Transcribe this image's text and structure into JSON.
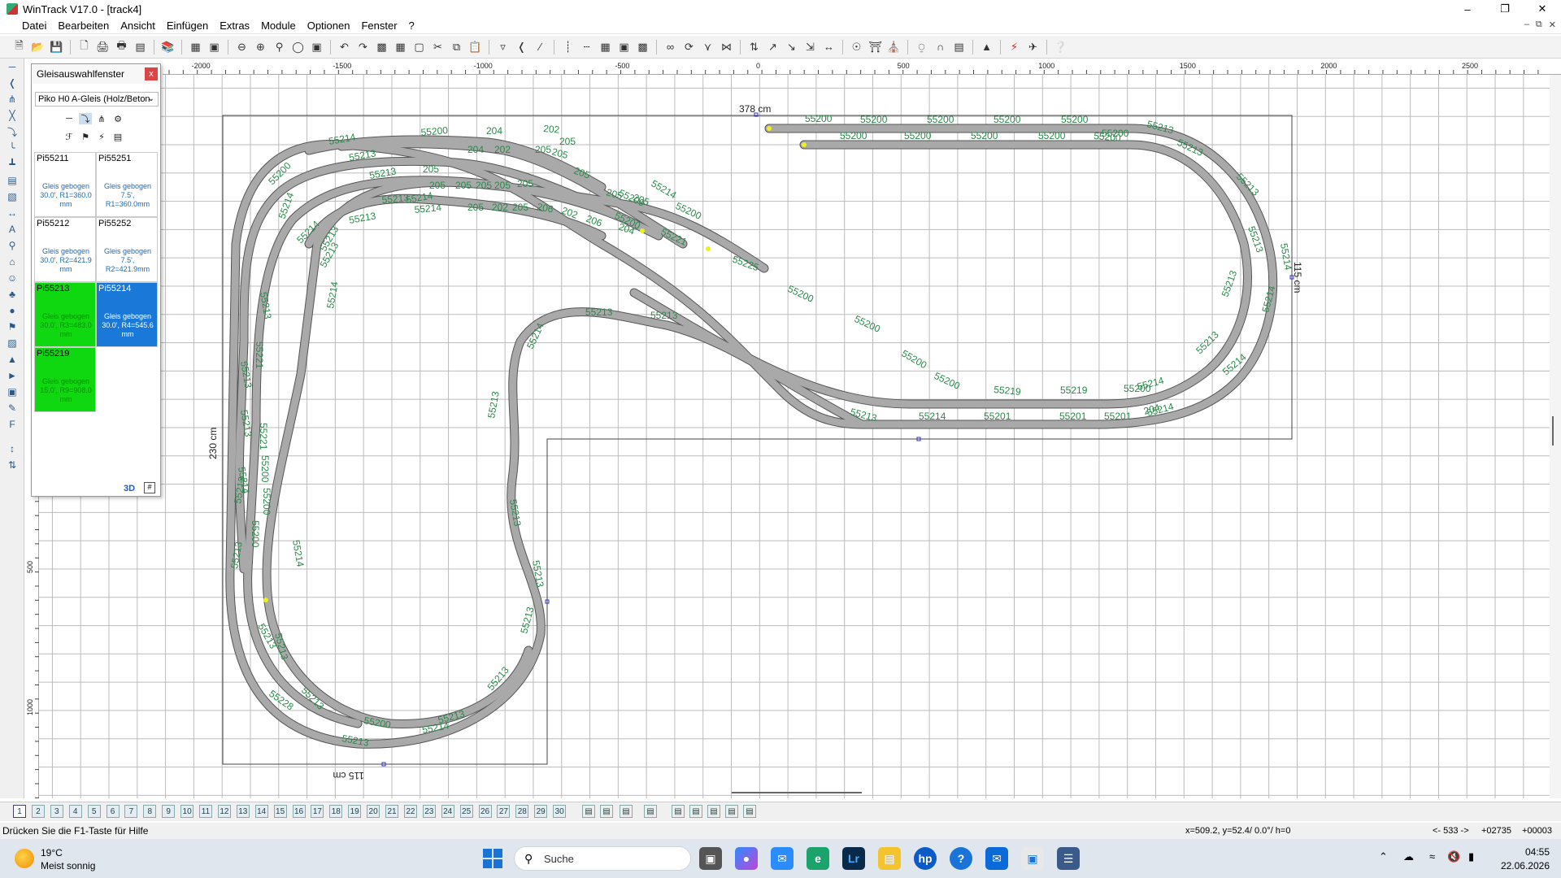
{
  "window": {
    "title": "WinTrack  V17.0 - [track4]",
    "minimize": "–",
    "maximize": "❐",
    "close": "✕"
  },
  "menu": [
    "Datei",
    "Bearbeiten",
    "Ansicht",
    "Einfügen",
    "Extras",
    "Module",
    "Optionen",
    "Fenster",
    "?"
  ],
  "panel": {
    "title": "Gleisauswahlfenster",
    "close": "x",
    "catalog": "Piko H0 A-Gleis (Holz/Beton",
    "button_3d": "3D",
    "items": [
      {
        "id": "Pi55211",
        "desc": "Gleis gebogen 30.0', R1=360.0 mm",
        "state": "normal"
      },
      {
        "id": "Pi55251",
        "desc": "Gleis gebogen 7.5', R1=360.0mm",
        "state": "normal"
      },
      {
        "id": "Pi55212",
        "desc": "Gleis gebogen 30.0', R2=421.9 mm",
        "state": "normal"
      },
      {
        "id": "Pi55252",
        "desc": "Gleis gebogen 7.5', R2=421.9mm",
        "state": "normal"
      },
      {
        "id": "Pi55213",
        "desc": "Gleis gebogen 30.0', R3=483.0 mm",
        "state": "green"
      },
      {
        "id": "Pi55214",
        "desc": "Gleis gebogen 30.0', R4=545.6 mm",
        "state": "blue"
      },
      {
        "id": "Pi55219",
        "desc": "Gleis gebogen 15.0', R9=908.0 mm",
        "state": "green"
      }
    ]
  },
  "ruler_top": [
    "-2000",
    "-1500",
    "-1000",
    "-500",
    "0",
    "500",
    "1000",
    "1500",
    "2000",
    "2500"
  ],
  "ruler_left": [
    "500",
    "1000"
  ],
  "dimensions": {
    "top": "378 cm",
    "right": "115 cm",
    "left": "230 cm",
    "bottom": "115 cm"
  },
  "track_labels": [
    "55200",
    "55200",
    "55200",
    "55200",
    "55200",
    "55200",
    "55200",
    "55200",
    "55200",
    "55200",
    "55200",
    "55213",
    "55213",
    "55213",
    "55213",
    "55213",
    "55213",
    "55214",
    "55214",
    "55214",
    "55214",
    "55214",
    "55214",
    "55209",
    "55200",
    "55200",
    "55221",
    "55225",
    "55200",
    "55200",
    "55200",
    "55200",
    "55219",
    "55219",
    "55200",
    "55213",
    "55213",
    "55213",
    "55214",
    "55201",
    "55201",
    "55201",
    "204",
    "55214",
    "55213",
    "55213",
    "55213",
    "55213",
    "55213",
    "55213",
    "55200",
    "55213",
    "55213",
    "55213",
    "55213",
    "55214",
    "55213",
    "55213",
    "55213",
    "55228",
    "55213",
    "55214",
    "55214",
    "55214",
    "55213",
    "55213",
    "55221",
    "55221",
    "55200",
    "55200",
    "55200",
    "55200",
    "55214",
    "55214",
    "55213",
    "55213",
    "55213",
    "55214",
    "55214",
    "55213",
    "55213",
    "55214",
    "55200",
    "204",
    "204",
    "202",
    "205",
    "205",
    "202",
    "205",
    "205",
    "205",
    "205",
    "205",
    "205",
    "205",
    "205",
    "205",
    "205",
    "205",
    "202",
    "205",
    "206",
    "202",
    "206",
    "204"
  ],
  "pages": [
    "1",
    "2",
    "3",
    "4",
    "5",
    "6",
    "7",
    "8",
    "9",
    "10",
    "11",
    "12",
    "13",
    "14",
    "15",
    "16",
    "17",
    "18",
    "19",
    "20",
    "21",
    "22",
    "23",
    "24",
    "25",
    "26",
    "27",
    "28",
    "29",
    "30"
  ],
  "status": {
    "help": "Drücken Sie die  F1-Taste für Hilfe",
    "coords": "x=509.2, y=52.4/ 0.0°/ h=0",
    "distance": "<- 533 ->",
    "value_a": "+02735",
    "value_b": "+00003"
  },
  "taskbar": {
    "temperature": "19°C",
    "weather": "Meist sonnig",
    "search_placeholder": "Suche",
    "time": "04:55",
    "date": "22.06.2026"
  },
  "colors": {
    "track": "#a9a9a9",
    "track_border": "#555555",
    "label": "#2a8a4a",
    "selected_blue": "#1a78d8",
    "selected_green": "#10d810"
  }
}
